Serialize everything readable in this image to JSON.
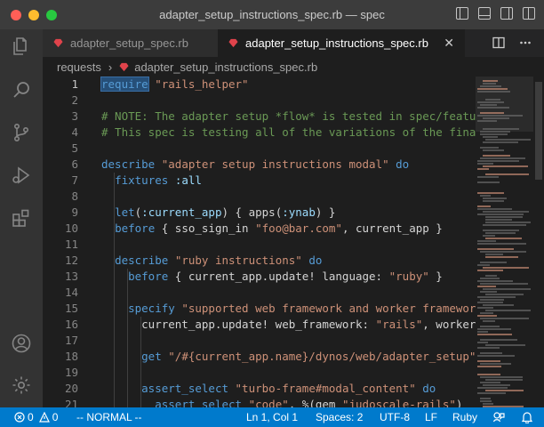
{
  "window": {
    "title": "adapter_setup_instructions_spec.rb — spec"
  },
  "tabs": [
    {
      "label": "adapter_setup_spec.rb",
      "active": false
    },
    {
      "label": "adapter_setup_instructions_spec.rb",
      "active": true,
      "close": "✕"
    }
  ],
  "breadcrumb": {
    "folder": "requests",
    "separator": "›",
    "file": "adapter_setup_instructions_spec.rb"
  },
  "editor": {
    "lines": [
      {
        "n": "1",
        "text": "require \"rails_helper\""
      },
      {
        "n": "2",
        "text": ""
      },
      {
        "n": "3",
        "text": "# NOTE: The adapter setup *flow* is tested in spec/feature"
      },
      {
        "n": "4",
        "text": "# This spec is testing all of the variations of the final"
      },
      {
        "n": "5",
        "text": ""
      },
      {
        "n": "6",
        "text": "describe \"adapter setup instructions modal\" do"
      },
      {
        "n": "7",
        "text": "  fixtures :all"
      },
      {
        "n": "8",
        "text": ""
      },
      {
        "n": "9",
        "text": "  let(:current_app) { apps(:ynab) }"
      },
      {
        "n": "10",
        "text": "  before { sso_sign_in \"foo@bar.com\", current_app }"
      },
      {
        "n": "11",
        "text": ""
      },
      {
        "n": "12",
        "text": "  describe \"ruby instructions\" do"
      },
      {
        "n": "13",
        "text": "    before { current_app.update! language: \"ruby\" }"
      },
      {
        "n": "14",
        "text": ""
      },
      {
        "n": "15",
        "text": "    specify \"supported web framework and worker framework\""
      },
      {
        "n": "16",
        "text": "      current_app.update! web_framework: \"rails\", worker_f"
      },
      {
        "n": "17",
        "text": ""
      },
      {
        "n": "18",
        "text": "      get \"/#{current_app.name}/dynos/web/adapter_setup\""
      },
      {
        "n": "19",
        "text": ""
      },
      {
        "n": "20",
        "text": "      assert_select \"turbo-frame#modal_content\" do"
      },
      {
        "n": "21",
        "text": "        assert_select \"code\", %(gem \"judoscale-rails\")"
      }
    ]
  },
  "statusbar": {
    "errors": "0",
    "warnings": "0",
    "mode": "-- NORMAL --",
    "position": "Ln 1, Col 1",
    "spaces": "Spaces: 2",
    "encoding": "UTF-8",
    "eol": "LF",
    "language": "Ruby"
  },
  "colors": {
    "accent": "#007acc",
    "keyword": "#569cd6",
    "string": "#ce9178",
    "comment": "#6a9955",
    "ruby": "#e0434b"
  },
  "icons": {
    "activity": [
      "files-icon",
      "search-icon",
      "source-control-icon",
      "run-debug-icon",
      "extensions-icon",
      "account-icon",
      "settings-gear-icon"
    ],
    "tab_actions": [
      "split-editor-icon",
      "more-actions-icon"
    ]
  }
}
